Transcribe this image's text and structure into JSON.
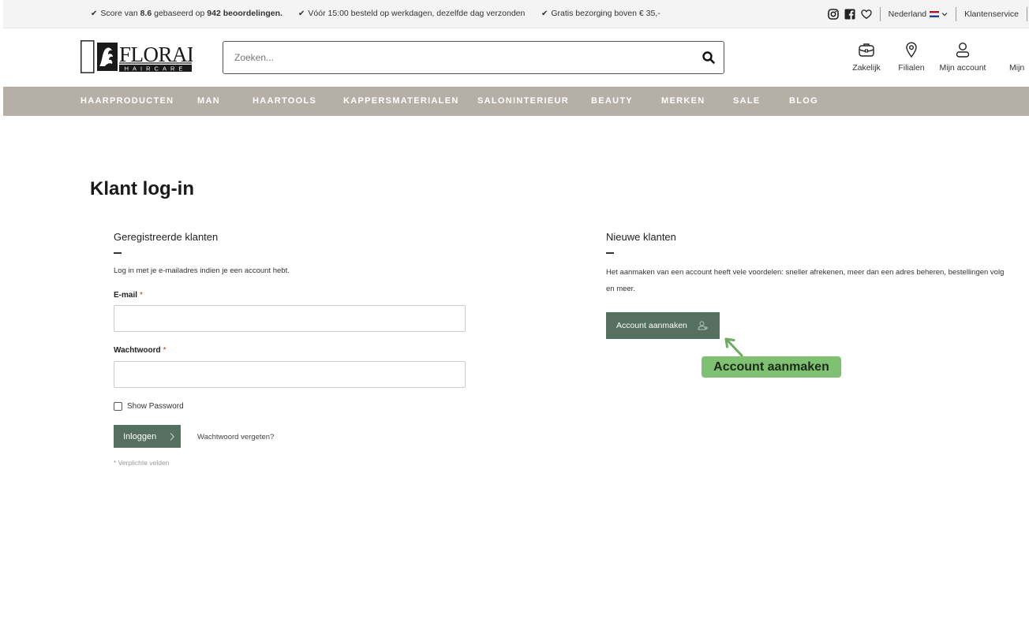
{
  "topbar": {
    "usp_score": {
      "prefix": "Score van ",
      "score": "8.6",
      "middle": " gebaseerd op ",
      "reviews": "942 beoordelingen."
    },
    "usp_shipping": "Vóór 15:00 besteld op werkdagen, dezelfde dag verzonden",
    "usp_delivery": "Gratis bezorging boven € 35,-",
    "check_icon": "✔",
    "country": "Nederland",
    "service": "Klantenservice",
    "social_icons": [
      "instagram-icon",
      "facebook-icon",
      "heart-icon"
    ],
    "flag_colors": [
      "#ae1c28",
      "#ffffff",
      "#21468b"
    ]
  },
  "header": {
    "logo_name": "Florale Haircare",
    "search_placeholder": "Zoeken...",
    "icons": [
      {
        "label": "Zakelijk",
        "icon": "briefcase-icon"
      },
      {
        "label": "Filialen",
        "icon": "location-pin-icon"
      },
      {
        "label": "Mijn account",
        "icon": "user-icon"
      },
      {
        "label": "Mijn",
        "icon": "wishlist-icon"
      }
    ]
  },
  "nav": {
    "items": [
      "HAARPRODUCTEN",
      "MAN",
      "HAARTOOLS",
      "KAPPERSMATERIALEN",
      "SALONINTERIEUR",
      "BEAUTY",
      "MERKEN",
      "SALE",
      "BLOG"
    ],
    "background": "#b6afa8"
  },
  "main": {
    "page_title": "Klant log-in",
    "registered": {
      "title": "Geregistreerde klanten",
      "intro": "Log in met je e-mailadres indien je een account hebt.",
      "email_label": "E-mail",
      "password_label": "Wachtwoord",
      "required_mark": "*",
      "email_value": "",
      "password_value": "",
      "show_password": "Show Password",
      "login_button": "Inloggen",
      "forgot_link": "Wachtwoord vergeten?",
      "required_note": "* Verplichte velden"
    },
    "new_customers": {
      "title": "Nieuwe klanten",
      "text_line1": "Het aanmaken van een account heeft vele voordelen: sneller afrekenen, meer dan een adres beheren, bestellingen volg",
      "text_line2": "en meer.",
      "create_button": "Account aanmaken"
    }
  },
  "annotation": {
    "label": "Account aanmaken",
    "color": "#7fc072"
  },
  "colors": {
    "button": "#557060",
    "nav": "#b6afa8"
  }
}
